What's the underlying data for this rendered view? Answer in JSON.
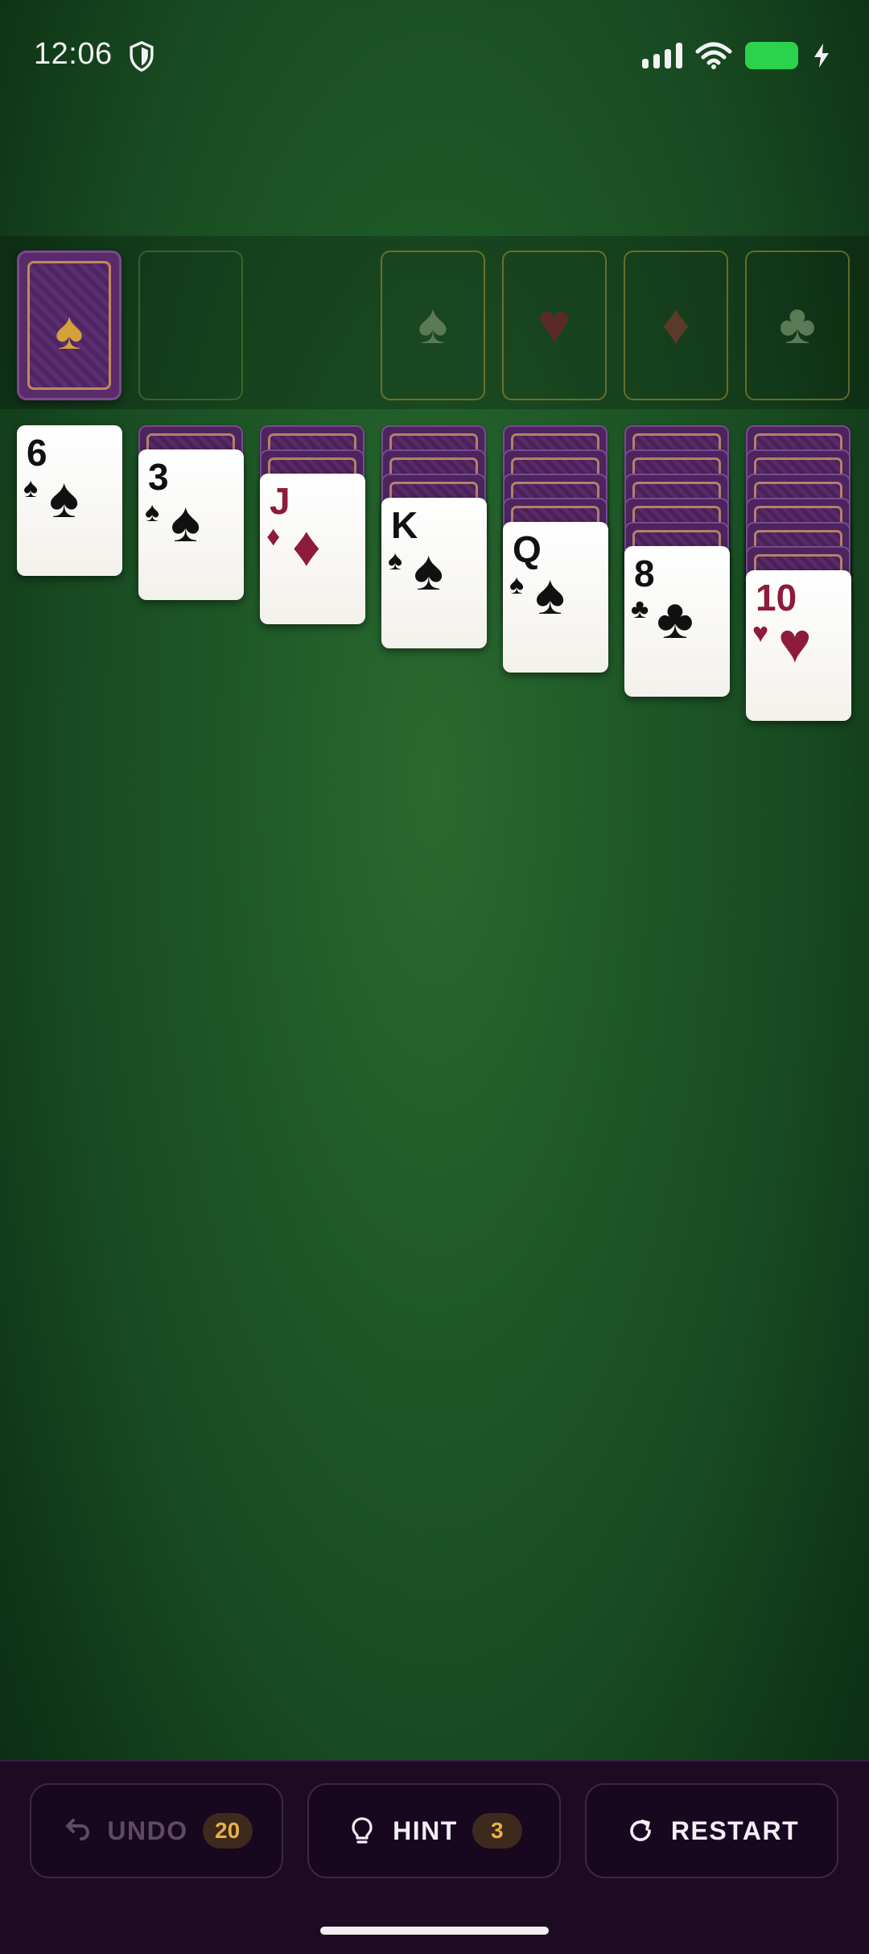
{
  "status": {
    "time": "12:06"
  },
  "stock": {
    "suit_symbol": "♠",
    "color": "#d4a23a"
  },
  "foundations": [
    {
      "suit": "spades",
      "symbol": "♠",
      "color": "#5a7a55"
    },
    {
      "suit": "hearts",
      "symbol": "♥",
      "color": "#5a2a28"
    },
    {
      "suit": "diamonds",
      "symbol": "♦",
      "color": "#5a3a28"
    },
    {
      "suit": "clubs",
      "symbol": "♣",
      "color": "#5a7a55"
    }
  ],
  "tableau": [
    {
      "hidden": 0,
      "top": {
        "rank": "6",
        "suit": "♠",
        "color": "black"
      }
    },
    {
      "hidden": 1,
      "top": {
        "rank": "3",
        "suit": "♠",
        "color": "black"
      }
    },
    {
      "hidden": 2,
      "top": {
        "rank": "J",
        "suit": "♦",
        "color": "red"
      }
    },
    {
      "hidden": 3,
      "top": {
        "rank": "K",
        "suit": "♠",
        "color": "black"
      }
    },
    {
      "hidden": 4,
      "top": {
        "rank": "Q",
        "suit": "♠",
        "color": "black"
      }
    },
    {
      "hidden": 5,
      "top": {
        "rank": "8",
        "suit": "♣",
        "color": "black"
      }
    },
    {
      "hidden": 6,
      "top": {
        "rank": "10",
        "suit": "♥",
        "color": "red"
      }
    }
  ],
  "controls": {
    "undo": {
      "label": "UNDO",
      "count": "20",
      "enabled": false
    },
    "hint": {
      "label": "HINT",
      "count": "3"
    },
    "restart": {
      "label": "RESTART"
    }
  }
}
